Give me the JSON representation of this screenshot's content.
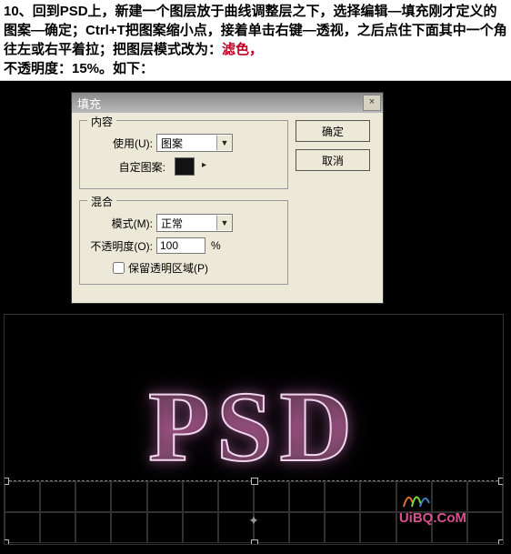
{
  "instruction": {
    "step_num": "10、",
    "text1": "回到PSD上，新建一个图层放于曲线调整层之下，选择编辑—填充刚才定义的图案—确定；Ctrl+T把图案缩小点，接着单击右键—透视，之后点住下面其中一个角往左或右平着拉；把图层模式改为：",
    "highlight": "滤色，",
    "text2": "不透明度：15%。如下："
  },
  "dialog": {
    "title": "填充",
    "close_icon": "×",
    "content_group": "内容",
    "use_label": "使用(U):",
    "use_value": "图案",
    "custom_pattern_label": "自定图案:",
    "blend_group": "混合",
    "mode_label": "模式(M):",
    "mode_value": "正常",
    "opacity_label": "不透明度(O):",
    "opacity_value": "100",
    "opacity_unit": "%",
    "preserve_trans_label": "保留透明区域(P)",
    "ok_button": "确定",
    "cancel_button": "取消"
  },
  "image": {
    "psd_text": "PSD",
    "watermark_site": "UiBQ.CoM"
  }
}
